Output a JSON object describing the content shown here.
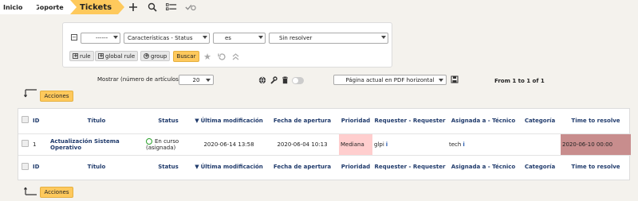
{
  "breadcrumb": {
    "home": "Inicio",
    "support": "Soporte",
    "current": "Tickets"
  },
  "toolbar_icons": [
    "add-icon",
    "search-icon",
    "list-icon",
    "check-icon"
  ],
  "search": {
    "criteria": {
      "field_1": "------",
      "field_2": "Características - Status",
      "operator": "es",
      "value": "Sin resolver"
    },
    "buttons": {
      "rule": "rule",
      "global_rule": "global rule",
      "group": "group",
      "search": "Buscar"
    }
  },
  "list_controls": {
    "show_label": "Mostrar (número de artículos)",
    "per_page": "20",
    "export": "Página actual en PDF horizontal",
    "pager": "From 1 to 1 of 1"
  },
  "actions_label": "Acciones",
  "table": {
    "columns": [
      "ID",
      "Título",
      "Status",
      "Última modificación",
      "Fecha de apertura",
      "Prioridad",
      "Requester - Requester",
      "Asignada a - Técnico",
      "Categoría",
      "Time to resolve"
    ],
    "rows": [
      {
        "id": "1",
        "title": "Actualización Sistema Operativo",
        "status": "En curso (asignada)",
        "last_modified": "2020-06-14 13:58",
        "opened": "2020-06-04 10:13",
        "priority": "Mediana",
        "requester": "glpi",
        "assigned": "tech",
        "category": "",
        "time_to_resolve": "2020-06-10 00:00"
      }
    ]
  },
  "colors": {
    "accent": "#fec95c",
    "priority_bg": "#ffcece",
    "ttr_bg": "#c88d8d",
    "header_text": "#1f3a6b",
    "status_green": "#2aa02a"
  }
}
